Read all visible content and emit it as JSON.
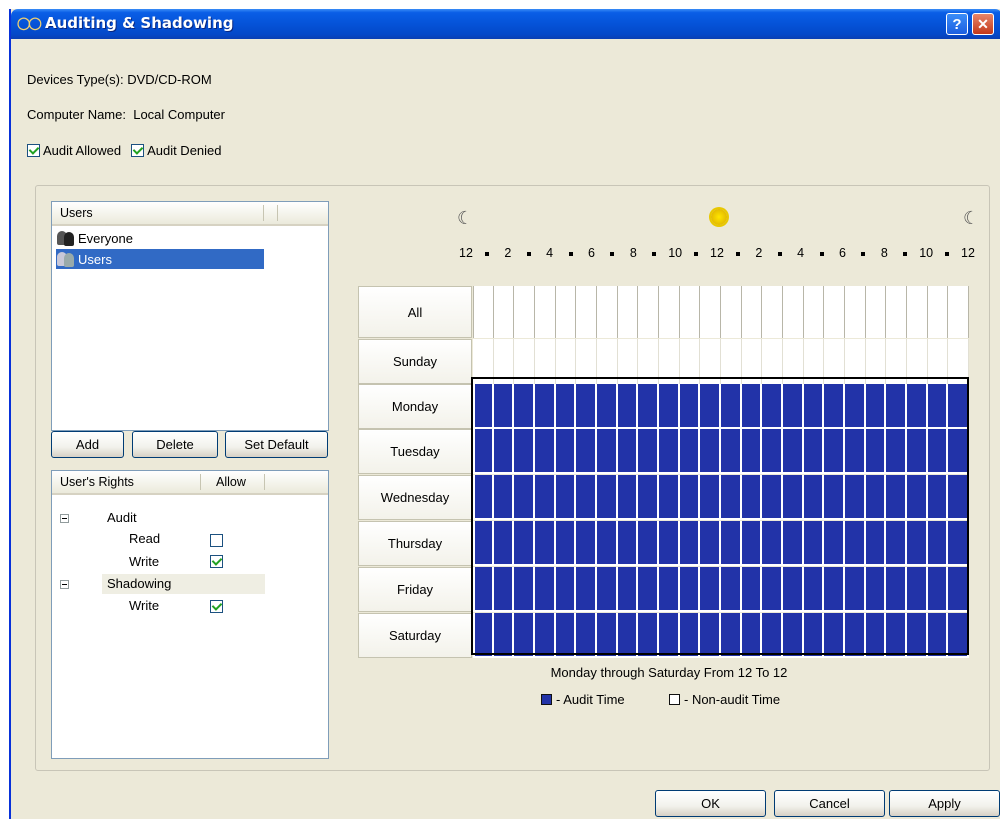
{
  "window": {
    "title": "Auditing & Shadowing",
    "help": "?",
    "close": "✕"
  },
  "info": {
    "device_type_label": "Devices Type(s):",
    "device_type_value": "DVD/CD-ROM",
    "computer_name_label": "Computer Name:",
    "computer_name_value": "Local Computer"
  },
  "checkboxes": [
    {
      "label": "Audit Allowed",
      "checked": true
    },
    {
      "label": "Audit Denied",
      "checked": true
    }
  ],
  "users": {
    "header": "Users",
    "items": [
      {
        "name": "Everyone",
        "selected": false
      },
      {
        "name": "Users",
        "selected": true
      }
    ]
  },
  "user_buttons": {
    "add": "Add",
    "delete": "Delete",
    "set_default": "Set Default"
  },
  "rights": {
    "header_name": "User's Rights",
    "header_allow": "Allow",
    "groups": [
      {
        "name": "Audit",
        "items": [
          {
            "name": "Read",
            "allowed": false
          },
          {
            "name": "Write",
            "allowed": true
          }
        ]
      },
      {
        "name": "Shadowing",
        "items": [
          {
            "name": "Write",
            "allowed": true
          }
        ]
      }
    ]
  },
  "schedule": {
    "hour_labels": [
      "12",
      "2",
      "4",
      "6",
      "8",
      "10",
      "12",
      "2",
      "4",
      "6",
      "8",
      "10",
      "12"
    ],
    "days": [
      "All",
      "Sunday",
      "Monday",
      "Tuesday",
      "Wednesday",
      "Thursday",
      "Friday",
      "Saturday"
    ],
    "audited_days": [
      "Monday",
      "Tuesday",
      "Wednesday",
      "Thursday",
      "Friday",
      "Saturday"
    ],
    "summary": "Monday through Saturday From 12 To 12",
    "legend_audit": "- Audit Time",
    "legend_non_audit": "- Non-audit Time",
    "audit_color": "#2233a8",
    "non_audit_color": "#ffffff"
  },
  "dialog_buttons": {
    "ok": "OK",
    "cancel": "Cancel",
    "apply": "Apply"
  }
}
